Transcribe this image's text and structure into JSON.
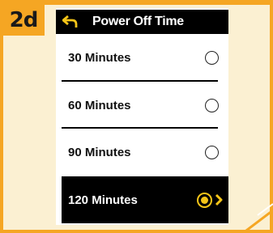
{
  "step_badge": "2d",
  "header": {
    "title": "Power Off Time",
    "back_icon": "back-arrow-icon"
  },
  "options": [
    {
      "label": "30 Minutes",
      "selected": false
    },
    {
      "label": "60 Minutes",
      "selected": false
    },
    {
      "label": "90 Minutes",
      "selected": false
    },
    {
      "label": "120 Minutes",
      "selected": true
    }
  ],
  "colors": {
    "frame": "#f5a623",
    "background": "#fbf0d2",
    "accent": "#f5c518",
    "bar": "#000000"
  }
}
